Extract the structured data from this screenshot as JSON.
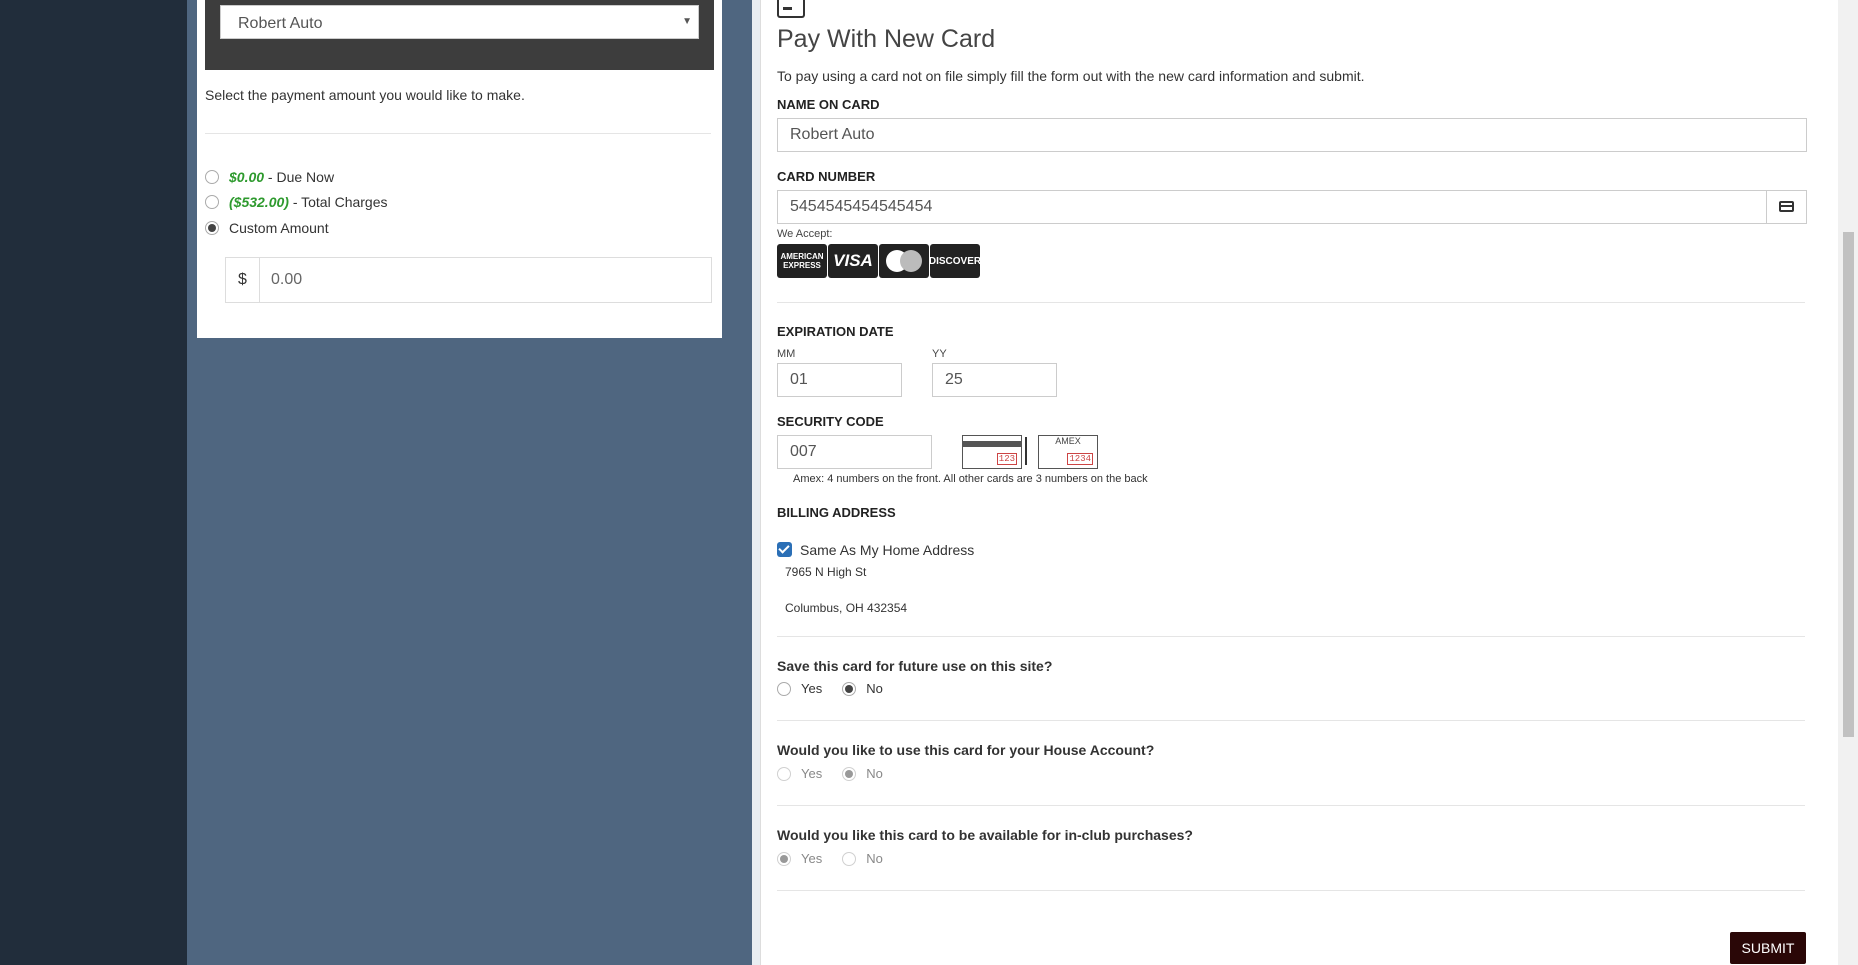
{
  "left": {
    "name_select_value": "Robert Auto",
    "instruction": "Select the payment amount you would like to make.",
    "options": [
      {
        "amount": "$0.00",
        "label": " - Due Now"
      },
      {
        "amount": "($532.00)",
        "label": " - Total Charges"
      },
      {
        "amount": "",
        "label": "Custom Amount"
      }
    ],
    "currency_symbol": "$",
    "custom_amount_value": "0.00"
  },
  "form": {
    "title": "Pay With New Card",
    "instruction": "To pay using a card not on file simply fill the form out with the new card information and submit.",
    "name_label": "NAME ON CARD",
    "name_value": "Robert Auto",
    "card_label": "CARD NUMBER",
    "card_value": "5454545454545454",
    "we_accept": "We Accept:",
    "brands": {
      "amex": "AMERICAN EXPRESS",
      "visa": "VISA",
      "discover": "DISCOVER"
    },
    "exp_label": "EXPIRATION DATE",
    "mm_label": "MM",
    "mm_value": "01",
    "yy_label": "YY",
    "yy_value": "25",
    "sec_label": "SECURITY CODE",
    "sec_value": "007",
    "sec_img_back_num": "123",
    "sec_img_amex_label": "AMEX",
    "sec_img_amex_num": "1234",
    "sec_note": "Amex: 4 numbers on the front. All other cards are 3 numbers on the back",
    "billing_label": "BILLING ADDRESS",
    "same_address_label": "Same As My Home Address",
    "address_line1": "7965 N High St",
    "address_line2": "Columbus, OH 432354",
    "q_save": "Save this card for future use on this site?",
    "q_house": "Would you like to use this card for your House Account?",
    "q_club": "Would you like this card to be available for in-club purchases?",
    "yes": "Yes",
    "no": "No",
    "submit": "SUBMIT"
  }
}
